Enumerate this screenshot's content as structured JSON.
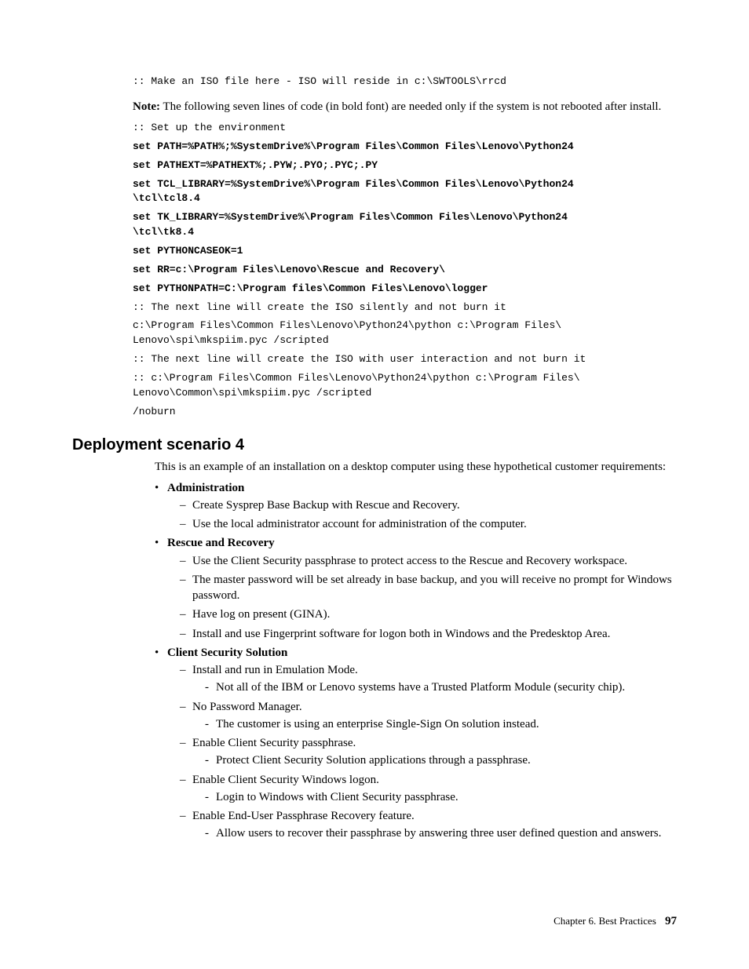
{
  "code": {
    "line1": ":: Make an ISO file here - ISO will reside in c:\\SWTOOLS\\rrcd",
    "line2": ":: Set up the environment",
    "line3": "set PATH=%PATH%;%SystemDrive%\\Program Files\\Common Files\\Lenovo\\Python24",
    "line4": "set PATHEXT=%PATHEXT%;.PYW;.PYO;.PYC;.PY",
    "line5": "set TCL_LIBRARY=%SystemDrive%\\Program Files\\Common Files\\Lenovo\\Python24\n\\tcl\\tcl8.4",
    "line6": "set TK_LIBRARY=%SystemDrive%\\Program Files\\Common Files\\Lenovo\\Python24\n\\tcl\\tk8.4",
    "line7": "set PYTHONCASEOK=1",
    "line8": "set RR=c:\\Program Files\\Lenovo\\Rescue and Recovery\\",
    "line9": "set PYTHONPATH=C:\\Program files\\Common Files\\Lenovo\\logger",
    "line10": ":: The next line will create the ISO silently and not burn it",
    "line11": "c:\\Program Files\\Common Files\\Lenovo\\Python24\\python c:\\Program Files\\\nLenovo\\spi\\mkspiim.pyc /scripted",
    "line12": ":: The next line will create the ISO with user interaction and not burn it",
    "line13": ":: c:\\Program Files\\Common Files\\Lenovo\\Python24\\python c:\\Program Files\\\nLenovo\\Common\\spi\\mkspiim.pyc /scripted",
    "line14": "/noburn"
  },
  "note": {
    "label": "Note:",
    "text": " The following seven lines of code (in bold font) are needed only if the system is not rebooted after install."
  },
  "heading": "Deployment scenario 4",
  "intro": "This is an example of an installation on a desktop computer using these hypothetical customer requirements:",
  "bullets": {
    "admin_label": "Administration",
    "admin_1": "Create Sysprep Base Backup with Rescue and Recovery.",
    "admin_2": "Use the local administrator account for administration of the computer.",
    "rr_label": "Rescue and Recovery",
    "rr_1": "Use the Client Security passphrase to protect access to the Rescue and Recovery workspace.",
    "rr_2": "The master password will be set already in base backup, and you will receive no prompt for Windows password.",
    "rr_3": "Have log on present (GINA).",
    "rr_4": "Install and use Fingerprint software for logon both in Windows and the Predesktop Area.",
    "css_label": " Client Security Solution",
    "css_1": "Install and run in Emulation Mode.",
    "css_1a": "Not all of the IBM or Lenovo systems have a Trusted Platform Module (security chip).",
    "css_2": "No Password Manager.",
    "css_2a": "The customer is using an enterprise Single-Sign On solution instead.",
    "css_3": " Enable Client Security passphrase.",
    "css_3a": "Protect Client Security Solution applications through a passphrase.",
    "css_4": " Enable Client Security Windows logon.",
    "css_4a": "Login to Windows with Client Security passphrase.",
    "css_5": "Enable End-User Passphrase Recovery feature.",
    "css_5a": "Allow users to recover their passphrase by answering three user defined question and answers."
  },
  "footer": {
    "chapter": "Chapter 6. Best Practices",
    "page": "97"
  }
}
